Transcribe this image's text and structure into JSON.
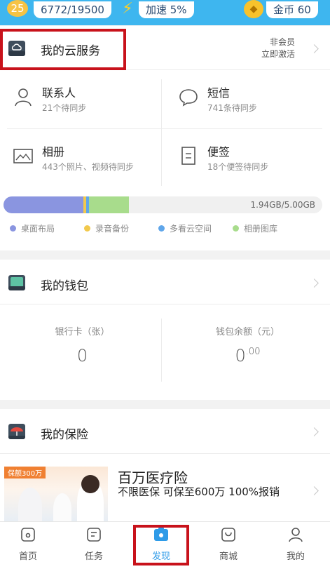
{
  "topbar": {
    "level": "25",
    "exp": "6772/19500",
    "speed": "加速 5%",
    "coins": "金币 60"
  },
  "cloud": {
    "title": "我的云服务",
    "member_status": "非会员",
    "member_action": "立即激活",
    "items": [
      {
        "title": "联系人",
        "sub": "21个待同步",
        "icon": "contact-icon"
      },
      {
        "title": "短信",
        "sub": "741条待同步",
        "icon": "sms-icon"
      },
      {
        "title": "相册",
        "sub": "443个照片、视频待同步",
        "icon": "album-icon"
      },
      {
        "title": "便签",
        "sub": "18个便签待同步",
        "icon": "note-icon"
      }
    ],
    "storage": {
      "text": "1.94GB/5.00GB",
      "used_gb": 1.94,
      "total_gb": 5.0
    },
    "legend": [
      {
        "label": "桌面布局",
        "color": "#8a95e0"
      },
      {
        "label": "录音备份",
        "color": "#f2c94c"
      },
      {
        "label": "多看云空间",
        "color": "#5fa6ea"
      },
      {
        "label": "相册图库",
        "color": "#a8dc8c"
      }
    ]
  },
  "wallet": {
    "title": "我的钱包",
    "bank_label": "银行卡（张）",
    "bank_value": "0",
    "balance_label": "钱包余额（元）",
    "balance_int": "0",
    "balance_dec": ".00"
  },
  "insurance": {
    "title": "我的保险",
    "banner_tag": "保额300万",
    "product_title": "百万医疗险",
    "product_sub": "不限医保 可保至600万 100%报销"
  },
  "nav": [
    {
      "label": "首页",
      "icon": "home-icon"
    },
    {
      "label": "任务",
      "icon": "task-icon"
    },
    {
      "label": "发现",
      "icon": "discover-icon",
      "active": true
    },
    {
      "label": "商城",
      "icon": "mall-icon"
    },
    {
      "label": "我的",
      "icon": "profile-icon"
    }
  ],
  "colors": {
    "accent": "#3eb6ef",
    "highlight": "#c8121b",
    "active_nav": "#2e9be8"
  }
}
